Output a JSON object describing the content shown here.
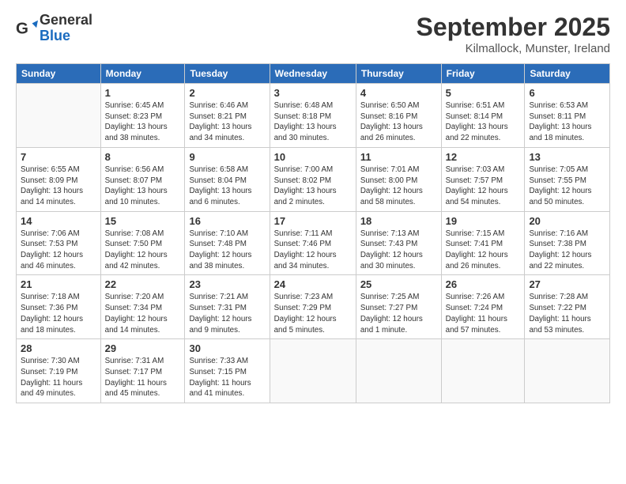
{
  "logo": {
    "general": "General",
    "blue": "Blue"
  },
  "title": "September 2025",
  "location": "Kilmallock, Munster, Ireland",
  "days_of_week": [
    "Sunday",
    "Monday",
    "Tuesday",
    "Wednesday",
    "Thursday",
    "Friday",
    "Saturday"
  ],
  "weeks": [
    [
      {
        "day": "",
        "info": ""
      },
      {
        "day": "1",
        "info": "Sunrise: 6:45 AM\nSunset: 8:23 PM\nDaylight: 13 hours\nand 38 minutes."
      },
      {
        "day": "2",
        "info": "Sunrise: 6:46 AM\nSunset: 8:21 PM\nDaylight: 13 hours\nand 34 minutes."
      },
      {
        "day": "3",
        "info": "Sunrise: 6:48 AM\nSunset: 8:18 PM\nDaylight: 13 hours\nand 30 minutes."
      },
      {
        "day": "4",
        "info": "Sunrise: 6:50 AM\nSunset: 8:16 PM\nDaylight: 13 hours\nand 26 minutes."
      },
      {
        "day": "5",
        "info": "Sunrise: 6:51 AM\nSunset: 8:14 PM\nDaylight: 13 hours\nand 22 minutes."
      },
      {
        "day": "6",
        "info": "Sunrise: 6:53 AM\nSunset: 8:11 PM\nDaylight: 13 hours\nand 18 minutes."
      }
    ],
    [
      {
        "day": "7",
        "info": "Sunrise: 6:55 AM\nSunset: 8:09 PM\nDaylight: 13 hours\nand 14 minutes."
      },
      {
        "day": "8",
        "info": "Sunrise: 6:56 AM\nSunset: 8:07 PM\nDaylight: 13 hours\nand 10 minutes."
      },
      {
        "day": "9",
        "info": "Sunrise: 6:58 AM\nSunset: 8:04 PM\nDaylight: 13 hours\nand 6 minutes."
      },
      {
        "day": "10",
        "info": "Sunrise: 7:00 AM\nSunset: 8:02 PM\nDaylight: 13 hours\nand 2 minutes."
      },
      {
        "day": "11",
        "info": "Sunrise: 7:01 AM\nSunset: 8:00 PM\nDaylight: 12 hours\nand 58 minutes."
      },
      {
        "day": "12",
        "info": "Sunrise: 7:03 AM\nSunset: 7:57 PM\nDaylight: 12 hours\nand 54 minutes."
      },
      {
        "day": "13",
        "info": "Sunrise: 7:05 AM\nSunset: 7:55 PM\nDaylight: 12 hours\nand 50 minutes."
      }
    ],
    [
      {
        "day": "14",
        "info": "Sunrise: 7:06 AM\nSunset: 7:53 PM\nDaylight: 12 hours\nand 46 minutes."
      },
      {
        "day": "15",
        "info": "Sunrise: 7:08 AM\nSunset: 7:50 PM\nDaylight: 12 hours\nand 42 minutes."
      },
      {
        "day": "16",
        "info": "Sunrise: 7:10 AM\nSunset: 7:48 PM\nDaylight: 12 hours\nand 38 minutes."
      },
      {
        "day": "17",
        "info": "Sunrise: 7:11 AM\nSunset: 7:46 PM\nDaylight: 12 hours\nand 34 minutes."
      },
      {
        "day": "18",
        "info": "Sunrise: 7:13 AM\nSunset: 7:43 PM\nDaylight: 12 hours\nand 30 minutes."
      },
      {
        "day": "19",
        "info": "Sunrise: 7:15 AM\nSunset: 7:41 PM\nDaylight: 12 hours\nand 26 minutes."
      },
      {
        "day": "20",
        "info": "Sunrise: 7:16 AM\nSunset: 7:38 PM\nDaylight: 12 hours\nand 22 minutes."
      }
    ],
    [
      {
        "day": "21",
        "info": "Sunrise: 7:18 AM\nSunset: 7:36 PM\nDaylight: 12 hours\nand 18 minutes."
      },
      {
        "day": "22",
        "info": "Sunrise: 7:20 AM\nSunset: 7:34 PM\nDaylight: 12 hours\nand 14 minutes."
      },
      {
        "day": "23",
        "info": "Sunrise: 7:21 AM\nSunset: 7:31 PM\nDaylight: 12 hours\nand 9 minutes."
      },
      {
        "day": "24",
        "info": "Sunrise: 7:23 AM\nSunset: 7:29 PM\nDaylight: 12 hours\nand 5 minutes."
      },
      {
        "day": "25",
        "info": "Sunrise: 7:25 AM\nSunset: 7:27 PM\nDaylight: 12 hours\nand 1 minute."
      },
      {
        "day": "26",
        "info": "Sunrise: 7:26 AM\nSunset: 7:24 PM\nDaylight: 11 hours\nand 57 minutes."
      },
      {
        "day": "27",
        "info": "Sunrise: 7:28 AM\nSunset: 7:22 PM\nDaylight: 11 hours\nand 53 minutes."
      }
    ],
    [
      {
        "day": "28",
        "info": "Sunrise: 7:30 AM\nSunset: 7:19 PM\nDaylight: 11 hours\nand 49 minutes."
      },
      {
        "day": "29",
        "info": "Sunrise: 7:31 AM\nSunset: 7:17 PM\nDaylight: 11 hours\nand 45 minutes."
      },
      {
        "day": "30",
        "info": "Sunrise: 7:33 AM\nSunset: 7:15 PM\nDaylight: 11 hours\nand 41 minutes."
      },
      {
        "day": "",
        "info": ""
      },
      {
        "day": "",
        "info": ""
      },
      {
        "day": "",
        "info": ""
      },
      {
        "day": "",
        "info": ""
      }
    ]
  ]
}
